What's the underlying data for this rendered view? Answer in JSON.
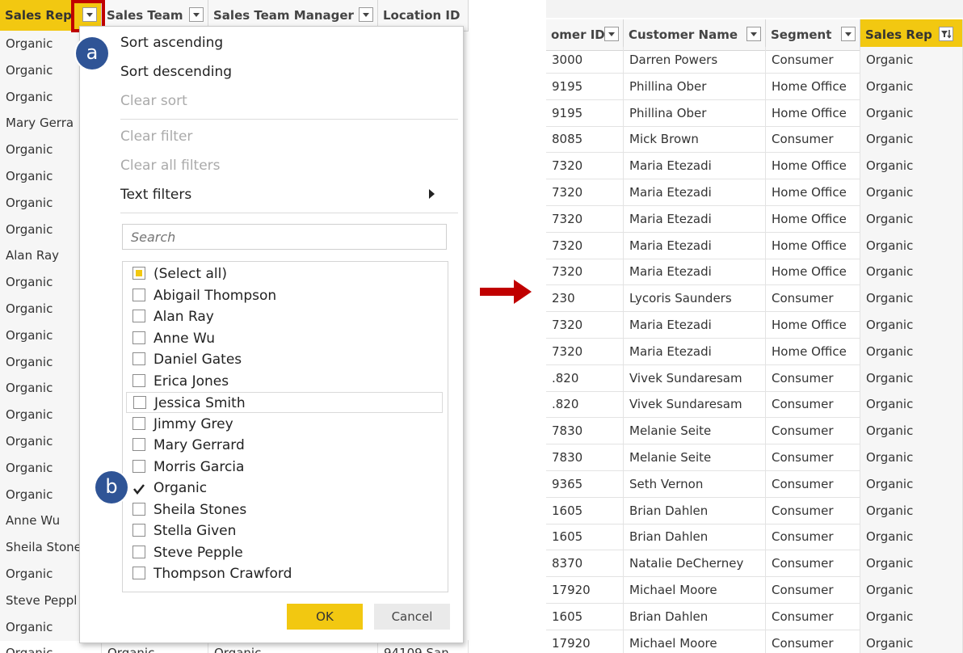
{
  "left_table": {
    "columns": [
      {
        "label": "Sales Rep",
        "selected": true
      },
      {
        "label": "Sales Team"
      },
      {
        "label": "Sales Team Manager"
      },
      {
        "label": "Location ID"
      }
    ],
    "sales_rep_values": [
      "Organic",
      "Organic",
      "Organic",
      "Mary Gerra",
      "Organic",
      "Organic",
      "Organic",
      "Organic",
      "Alan Ray",
      "Organic",
      "Organic",
      "Organic",
      "Organic",
      "Organic",
      "Organic",
      "Organic",
      "Organic",
      "Organic",
      "Anne Wu",
      "Sheila Stone",
      "Organic",
      "Steve Peppl",
      "Organic"
    ],
    "partial_last_row": [
      "Organic",
      "Organic",
      "Organic",
      "94109 San"
    ]
  },
  "menu": {
    "sort_ascending": "Sort ascending",
    "sort_descending": "Sort descending",
    "clear_sort": "Clear sort",
    "clear_filter": "Clear filter",
    "clear_all_filters": "Clear all filters",
    "text_filters": "Text filters",
    "search_placeholder": "Search",
    "options": [
      {
        "label": "(Select all)",
        "state": "partial"
      },
      {
        "label": "Abigail Thompson",
        "state": "off"
      },
      {
        "label": "Alan Ray",
        "state": "off"
      },
      {
        "label": "Anne Wu",
        "state": "off"
      },
      {
        "label": "Daniel Gates",
        "state": "off"
      },
      {
        "label": "Erica Jones",
        "state": "off"
      },
      {
        "label": "Jessica Smith",
        "state": "off",
        "highlight": true
      },
      {
        "label": "Jimmy Grey",
        "state": "off"
      },
      {
        "label": "Mary Gerrard",
        "state": "off"
      },
      {
        "label": "Morris Garcia",
        "state": "off"
      },
      {
        "label": "Organic",
        "state": "on"
      },
      {
        "label": "Sheila Stones",
        "state": "off"
      },
      {
        "label": "Stella Given",
        "state": "off"
      },
      {
        "label": "Steve Pepple",
        "state": "off"
      },
      {
        "label": "Thompson Crawford",
        "state": "off"
      }
    ],
    "ok_label": "OK",
    "cancel_label": "Cancel"
  },
  "badges": {
    "a": "a",
    "b": "b"
  },
  "right_table": {
    "columns": [
      {
        "label": "omer ID"
      },
      {
        "label": "Customer Name"
      },
      {
        "label": "Segment"
      },
      {
        "label": "Sales Rep",
        "selected": true,
        "filtered": true
      }
    ],
    "rows": [
      [
        "3000",
        "Darren Powers",
        "Consumer",
        "Organic"
      ],
      [
        "9195",
        "Phillina Ober",
        "Home Office",
        "Organic"
      ],
      [
        "9195",
        "Phillina Ober",
        "Home Office",
        "Organic"
      ],
      [
        "8085",
        "Mick Brown",
        "Consumer",
        "Organic"
      ],
      [
        "7320",
        "Maria Etezadi",
        "Home Office",
        "Organic"
      ],
      [
        "7320",
        "Maria Etezadi",
        "Home Office",
        "Organic"
      ],
      [
        "7320",
        "Maria Etezadi",
        "Home Office",
        "Organic"
      ],
      [
        "7320",
        "Maria Etezadi",
        "Home Office",
        "Organic"
      ],
      [
        "7320",
        "Maria Etezadi",
        "Home Office",
        "Organic"
      ],
      [
        "230",
        "Lycoris Saunders",
        "Consumer",
        "Organic"
      ],
      [
        "7320",
        "Maria Etezadi",
        "Home Office",
        "Organic"
      ],
      [
        "7320",
        "Maria Etezadi",
        "Home Office",
        "Organic"
      ],
      [
        ".820",
        "Vivek Sundaresam",
        "Consumer",
        "Organic"
      ],
      [
        ".820",
        "Vivek Sundaresam",
        "Consumer",
        "Organic"
      ],
      [
        "7830",
        "Melanie Seite",
        "Consumer",
        "Organic"
      ],
      [
        "7830",
        "Melanie Seite",
        "Consumer",
        "Organic"
      ],
      [
        "9365",
        "Seth Vernon",
        "Consumer",
        "Organic"
      ],
      [
        "1605",
        "Brian Dahlen",
        "Consumer",
        "Organic"
      ],
      [
        "1605",
        "Brian Dahlen",
        "Consumer",
        "Organic"
      ],
      [
        "8370",
        "Natalie DeCherney",
        "Consumer",
        "Organic"
      ],
      [
        "17920",
        "Michael Moore",
        "Consumer",
        "Organic"
      ],
      [
        "1605",
        "Brian Dahlen",
        "Consumer",
        "Organic"
      ],
      [
        "17920",
        "Michael Moore",
        "Consumer",
        "Organic"
      ]
    ]
  },
  "colors": {
    "accent": "#f2c811",
    "highlight_box": "#c00000",
    "badge": "#2f5496",
    "arrow": "#c00000"
  }
}
